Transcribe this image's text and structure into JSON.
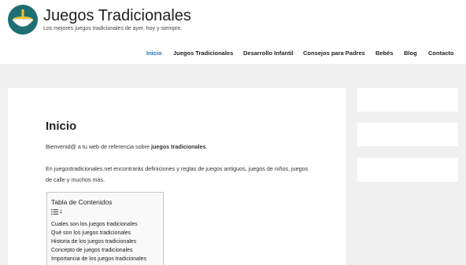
{
  "header": {
    "site_title": "Juegos Tradicionales",
    "tagline": "Los mejores juegos tradicionales de ayer, hoy y siempre."
  },
  "nav": [
    {
      "label": "Inicio",
      "active": true
    },
    {
      "label": "Juegos Tradicionales",
      "active": false
    },
    {
      "label": "Desarrollo Infantil",
      "active": false
    },
    {
      "label": "Consejos para Padres",
      "active": false
    },
    {
      "label": "Bebés",
      "active": false
    },
    {
      "label": "Blog",
      "active": false
    },
    {
      "label": "Contacto",
      "active": false
    }
  ],
  "main": {
    "title": "Inicio",
    "intro_prefix": "Bienvenid@ a  tu web de referencia sobre ",
    "intro_bold": "juegos tradicionales",
    "intro_suffix": ".",
    "paragraph": "En juegostradicionales.net encontrarás definiciones y reglas de juegos antiguos, juegos de niños, juegos de calle y muchos más."
  },
  "toc": {
    "title": "Tabla de Contenidos",
    "toggle": "1",
    "items": [
      "Cuales son los juegos tradicionales",
      "Qué son los juegos tradicionales",
      "Historia de los juegos tradicionales",
      "Concepto de juegos tradicionales",
      "Importancia de los juegos tradicionales"
    ]
  },
  "colors": {
    "accent": "#1e73be",
    "logo_bg": "#1e6f73",
    "page_bg": "#f0f0f0"
  }
}
